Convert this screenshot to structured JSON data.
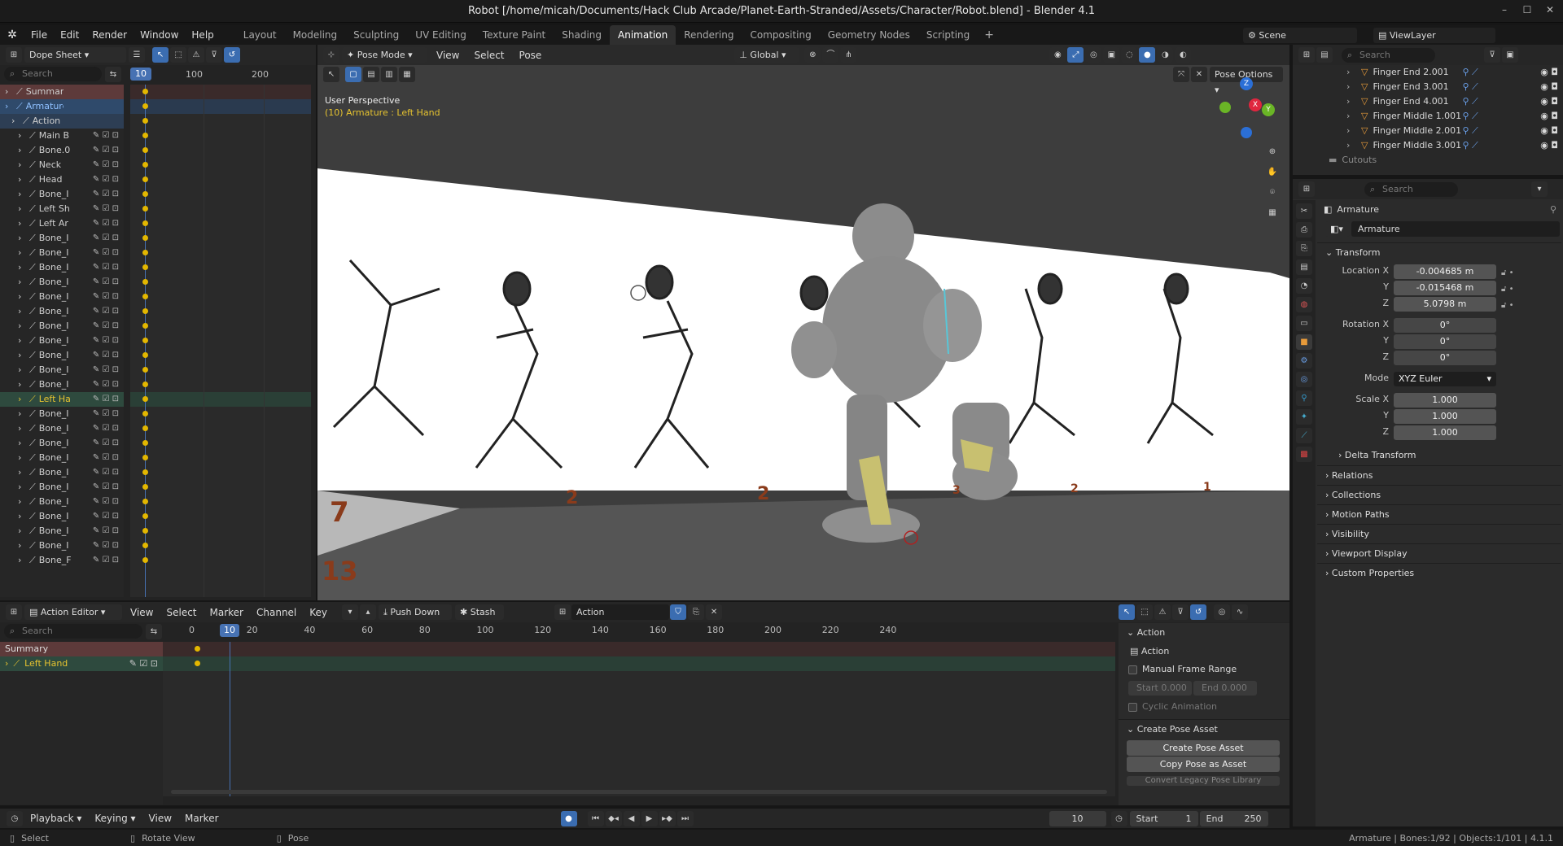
{
  "window": {
    "title": "Robot [/home/micah/Documents/Hack Club Arcade/Planet-Earth-Stranded/Assets/Character/Robot.blend] - Blender 4.1",
    "min": "–",
    "max": "☐",
    "close": "✕"
  },
  "menus": [
    "File",
    "Edit",
    "Render",
    "Window",
    "Help"
  ],
  "workspaces": [
    "Layout",
    "Modeling",
    "Sculpting",
    "UV Editing",
    "Texture Paint",
    "Shading",
    "Animation",
    "Rendering",
    "Compositing",
    "Geometry Nodes",
    "Scripting"
  ],
  "active_workspace": "Animation",
  "scene": {
    "scene_name": "Scene",
    "view_layer": "ViewLayer"
  },
  "dopesheet": {
    "mode": "Dope Sheet",
    "search_placeholder": "Search",
    "current_frame": "10",
    "ruler": [
      "100",
      "200"
    ],
    "channels": [
      "Summary",
      "Armature",
      "Action",
      "Main B",
      "Bone.0",
      "Neck",
      "Head",
      "Bone_I",
      "Left Sh",
      "Left Ar",
      "Bone_I",
      "Bone_I",
      "Bone_I",
      "Bone_I",
      "Bone_I",
      "Bone_I",
      "Bone_I",
      "Bone_I",
      "Bone_I",
      "Bone_I",
      "Bone_I",
      "Left Ha",
      "Bone_I",
      "Bone_I",
      "Bone_I",
      "Bone_I",
      "Bone_I",
      "Bone_I",
      "Bone_I",
      "Bone_I",
      "Bone_I",
      "Bone_I",
      "Bone_F"
    ]
  },
  "viewport": {
    "mode": "Pose Mode",
    "menus": [
      "View",
      "Select",
      "Pose"
    ],
    "orientation": "Global",
    "pose_options": "Pose Options",
    "perspective": "User Perspective",
    "context": "(10) Armature : Left Hand",
    "axes": {
      "z": "Z",
      "x": "X",
      "y": "Y"
    },
    "frame_numbers": [
      "7",
      "2",
      "2",
      "3",
      "2",
      "1",
      "13"
    ]
  },
  "outliner": {
    "search_placeholder": "Search",
    "items": [
      "Finger End 2.001",
      "Finger End 3.001",
      "Finger End 4.001",
      "Finger Middle 1.001",
      "Finger Middle 2.001",
      "Finger Middle 3.001"
    ],
    "collection": "Cutouts"
  },
  "properties": {
    "search_placeholder": "Search",
    "object": "Armature",
    "data_name": "Armature",
    "transform_label": "Transform",
    "location": {
      "label": "Location X",
      "x": "-0.004685 m",
      "y": "-0.015468 m",
      "z": "5.0798 m"
    },
    "rotation": {
      "label": "Rotation X",
      "x": "0°",
      "y": "0°",
      "z": "0°"
    },
    "mode_label": "Mode",
    "mode": "XYZ Euler",
    "scale": {
      "label": "Scale X",
      "x": "1.000",
      "y": "1.000",
      "z": "1.000"
    },
    "axis_y": "Y",
    "axis_z": "Z",
    "sections": [
      "Delta Transform",
      "Relations",
      "Collections",
      "Motion Paths",
      "Visibility",
      "Viewport Display",
      "Custom Properties"
    ]
  },
  "action_editor": {
    "mode": "Action Editor",
    "menus": [
      "View",
      "Select",
      "Marker",
      "Channel",
      "Key"
    ],
    "push_down": "Push Down",
    "stash": "Stash",
    "action_name": "Action",
    "search_placeholder": "Search",
    "current_frame": "10",
    "ruler": [
      "0",
      "20",
      "40",
      "60",
      "80",
      "100",
      "120",
      "140",
      "160",
      "180",
      "200",
      "220",
      "240"
    ],
    "channels": [
      "Summary",
      "Left Hand"
    ],
    "side_panel": {
      "action_header": "Action",
      "action_name": "Action",
      "manual_frame_range": "Manual Frame Range",
      "start": "Start  0.000",
      "end": "End  0.000",
      "cyclic": "Cyclic Animation",
      "pose_header": "Create Pose Asset",
      "create_pose": "Create Pose Asset",
      "copy_pose": "Copy Pose as Asset",
      "convert_legacy": "Convert Legacy Pose Library"
    }
  },
  "timeline": {
    "menus": [
      "Playback",
      "Keying",
      "View",
      "Marker"
    ],
    "frame": "10",
    "start_label": "Start",
    "start": "1",
    "end_label": "End",
    "end": "250"
  },
  "statusbar": {
    "select": "Select",
    "rotate": "Rotate View",
    "pose": "Pose",
    "info": "Armature | Bones:1/92 | Objects:1/101 | 4.1.1"
  }
}
